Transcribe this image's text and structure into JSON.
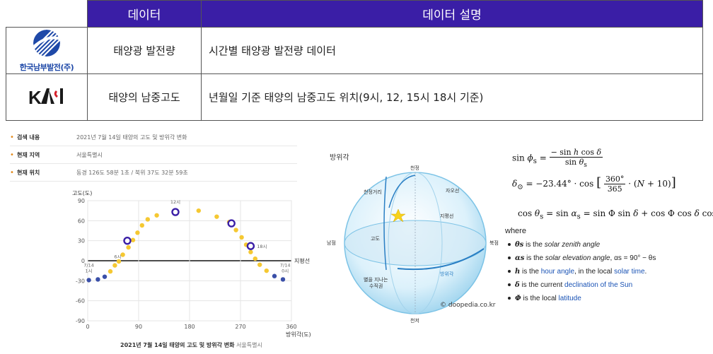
{
  "table": {
    "header": {
      "col_data": "데이터",
      "col_desc": "데이터 설명"
    },
    "rows": [
      {
        "logo_text": "한국남부발전(주)",
        "name": "태양광 발전량",
        "desc": "시간별 태양광 발전량 데이터"
      },
      {
        "logo_text": "KASI",
        "name": "태양의 남중고도",
        "desc": "년월일 기준 태양의 남중고도 위치(9시, 12, 15시 18시 기준)"
      }
    ]
  },
  "info": {
    "items": [
      {
        "label": "검색 내용",
        "value": "2021년 7월 14일 태양의 고도 및 방위각 변화"
      },
      {
        "label": "현재 지역",
        "value": "서울특별시"
      },
      {
        "label": "현재 위치",
        "value": "동경 126도 58분 1초 / 북위 37도 32분 59초"
      }
    ]
  },
  "chart_data": {
    "type": "scatter",
    "ylabel": "고도(도)",
    "xlabel": "방위각(도)",
    "xlim": [
      0,
      360
    ],
    "ylim": [
      -90,
      90
    ],
    "xticks": [
      0,
      90,
      180,
      270,
      360
    ],
    "yticks": [
      90,
      60,
      30,
      0,
      -30,
      -60,
      -90
    ],
    "horizon_label": "지평선",
    "caption": "2021년 7월 14일 태양의 고도 및 방위각 변화",
    "caption_sub": "서울특별시",
    "colors": {
      "hour_dot": "#f5c832",
      "marker": "#3a1ea6",
      "night": "#3a4fa8"
    },
    "points": [
      {
        "x": 2,
        "y": -29
      },
      {
        "x": 18,
        "y": -28
      },
      {
        "x": 30,
        "y": -24
      },
      {
        "x": 40,
        "y": -16
      },
      {
        "x": 48,
        "y": -7
      },
      {
        "x": 55,
        "y": -1
      },
      {
        "x": 62,
        "y": 9
      },
      {
        "x": 72,
        "y": 20
      },
      {
        "x": 80,
        "y": 31
      },
      {
        "x": 88,
        "y": 42
      },
      {
        "x": 96,
        "y": 53
      },
      {
        "x": 106,
        "y": 62
      },
      {
        "x": 122,
        "y": 68
      },
      {
        "x": 156,
        "y": 74
      },
      {
        "x": 196,
        "y": 75
      },
      {
        "x": 228,
        "y": 66
      },
      {
        "x": 250,
        "y": 58
      },
      {
        "x": 262,
        "y": 46
      },
      {
        "x": 272,
        "y": 35
      },
      {
        "x": 280,
        "y": 24
      },
      {
        "x": 288,
        "y": 13
      },
      {
        "x": 296,
        "y": 3
      },
      {
        "x": 304,
        "y": -6
      },
      {
        "x": 316,
        "y": -15
      },
      {
        "x": 330,
        "y": -23
      },
      {
        "x": 345,
        "y": -28
      }
    ],
    "markers": [
      {
        "x": 70,
        "y": 30
      },
      {
        "x": 155,
        "y": 73
      },
      {
        "x": 254,
        "y": 56
      },
      {
        "x": 288,
        "y": 22
      }
    ],
    "labeled": [
      {
        "x": 2,
        "y": -30,
        "label": "7/14 1시"
      },
      {
        "x": 68,
        "y": 7,
        "label": "6시"
      },
      {
        "x": 155,
        "y": 73,
        "label": "12시"
      },
      {
        "x": 288,
        "y": 22,
        "label": "18시"
      },
      {
        "x": 349,
        "y": -30,
        "label": "7/14 0시"
      }
    ]
  },
  "sphere": {
    "title": "방위각",
    "zenith": "천정",
    "nadir": "천저",
    "south": "남점",
    "north": "북점",
    "zenith_dist": "천정거리",
    "meridian": "자오선",
    "horizon": "지평선",
    "altitude": "고도",
    "azimuth": "방위각",
    "vertical_circle": "별을 지나는\n수직권",
    "copyright": "doopedia.co.kr"
  },
  "formulas": {
    "where": "where",
    "defs": [
      {
        "sym": "θs",
        "text_before": " is the ",
        "em": "solar zenith angle",
        "text_after": ""
      },
      {
        "sym": "αs",
        "text_before": " is the ",
        "em": "solar elevation angle",
        "text_after": ", αs = 90° − θs"
      },
      {
        "sym": "h",
        "text_before": " is the ",
        "link": "hour angle",
        "text_after": ", in the local ",
        "link2": "solar time",
        "tail": "."
      },
      {
        "sym": "δ",
        "text_before": " is the current ",
        "link": "declination of the Sun",
        "text_after": ""
      },
      {
        "sym": "Φ",
        "text_before": " is the local ",
        "link": "latitude",
        "text_after": ""
      }
    ]
  }
}
